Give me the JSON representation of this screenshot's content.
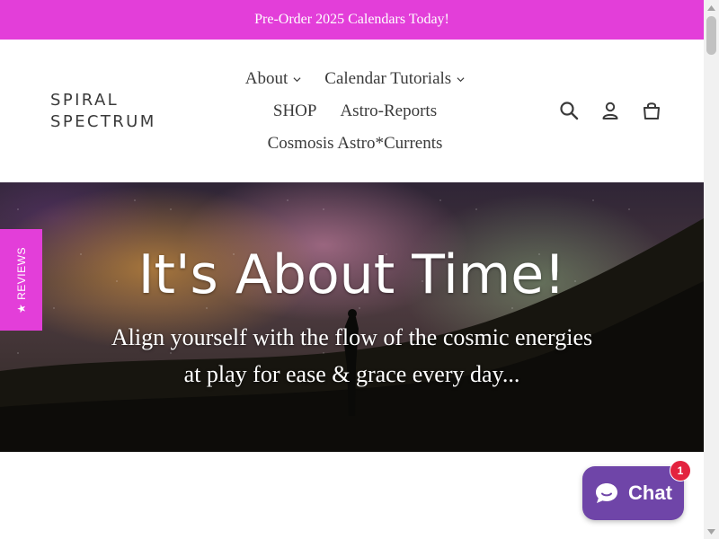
{
  "announcement": {
    "text": "Pre-Order 2025 Calendars Today!"
  },
  "header": {
    "logo_line1": "SPIRAL",
    "logo_line2": "SPECTRUM",
    "nav": {
      "about": "About",
      "calendar_tutorials": "Calendar Tutorials",
      "shop": "SHOP",
      "astro_reports": "Astro-Reports",
      "cosmosis": "Cosmosis Astro*Currents"
    },
    "icons": [
      "search-icon",
      "account-icon",
      "cart-icon"
    ]
  },
  "hero": {
    "title": "It's About Time!",
    "subtitle": "Align yourself with the flow of the cosmic energies at play for ease & grace every day..."
  },
  "reviews_tab": {
    "label": "★ REVIEWS"
  },
  "chat": {
    "label": "Chat",
    "badge": "1"
  },
  "colors": {
    "accent": "#e33ed9",
    "chat": "#6f45a8",
    "badge": "#e3233f"
  }
}
